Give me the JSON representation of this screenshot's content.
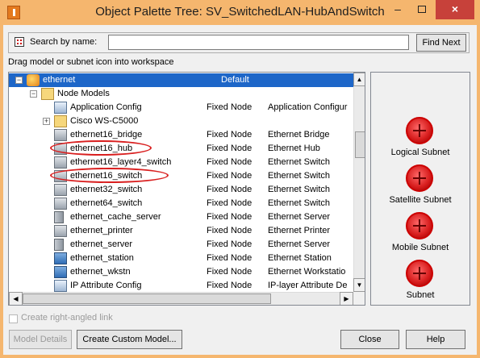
{
  "window": {
    "title": "Object Palette Tree: SV_SwitchedLAN-HubAndSwitch",
    "minimize": "–",
    "close": "×"
  },
  "search": {
    "label": "Search by name:",
    "value": "",
    "find_next": "Find Next"
  },
  "drag_hint": "Drag model or subnet icon into workspace",
  "tree": {
    "rows": [
      {
        "name": "ethernet",
        "type": "Default",
        "desc": "",
        "selected": true,
        "icon": "globe-icon",
        "expander": "−",
        "level": 0
      },
      {
        "name": "Node Models",
        "type": "",
        "desc": "",
        "icon": "folder-icon",
        "expander": "−",
        "level": 1
      },
      {
        "name": "Application Config",
        "type": "Fixed Node",
        "desc": "Application Configur",
        "icon": "application-config-icon",
        "level": 2
      },
      {
        "name": "Cisco WS-C5000",
        "type": "",
        "desc": "",
        "icon": "folder-icon",
        "expander": "+",
        "level": 2
      },
      {
        "name": "ethernet16_bridge",
        "type": "Fixed Node",
        "desc": "Ethernet Bridge",
        "icon": "bridge-icon",
        "level": 2
      },
      {
        "name": "ethernet16_hub",
        "type": "Fixed Node",
        "desc": "Ethernet Hub",
        "icon": "hub-icon",
        "level": 2,
        "circled": true
      },
      {
        "name": "ethernet16_layer4_switch",
        "type": "Fixed Node",
        "desc": "Ethernet Switch",
        "icon": "switch-icon",
        "level": 2
      },
      {
        "name": "ethernet16_switch",
        "type": "Fixed Node",
        "desc": "Ethernet Switch",
        "icon": "switch-icon",
        "level": 2,
        "circled": true
      },
      {
        "name": "ethernet32_switch",
        "type": "Fixed Node",
        "desc": "Ethernet Switch",
        "icon": "switch-icon",
        "level": 2
      },
      {
        "name": "ethernet64_switch",
        "type": "Fixed Node",
        "desc": "Ethernet Switch",
        "icon": "switch-icon",
        "level": 2
      },
      {
        "name": "ethernet_cache_server",
        "type": "Fixed Node",
        "desc": "Ethernet Server",
        "icon": "server-icon",
        "level": 2
      },
      {
        "name": "ethernet_printer",
        "type": "Fixed Node",
        "desc": "Ethernet Printer",
        "icon": "printer-icon",
        "level": 2
      },
      {
        "name": "ethernet_server",
        "type": "Fixed Node",
        "desc": "Ethernet Server",
        "icon": "server-icon",
        "level": 2
      },
      {
        "name": "ethernet_station",
        "type": "Fixed Node",
        "desc": "Ethernet Station",
        "icon": "station-icon",
        "level": 2
      },
      {
        "name": "ethernet_wkstn",
        "type": "Fixed Node",
        "desc": "Ethernet Workstatio",
        "icon": "workstation-icon",
        "level": 2
      },
      {
        "name": "IP Attribute Config",
        "type": "Fixed Node",
        "desc": "IP-layer Attribute De",
        "icon": "application-config-icon",
        "level": 2
      }
    ]
  },
  "subnets": [
    {
      "label": "Logical Subnet"
    },
    {
      "label": "Satellite Subnet"
    },
    {
      "label": "Mobile Subnet"
    },
    {
      "label": "Subnet"
    }
  ],
  "options": {
    "right_angled_link": "Create right-angled link"
  },
  "buttons": {
    "model_details": "Model Details",
    "create_custom_model": "Create Custom Model...",
    "close": "Close",
    "help": "Help"
  },
  "colors": {
    "title_bar": "#f5b66e",
    "selection": "#1d66c8",
    "highlight_ring": "#d91f1f",
    "subnet_red": "#d61b1b"
  }
}
